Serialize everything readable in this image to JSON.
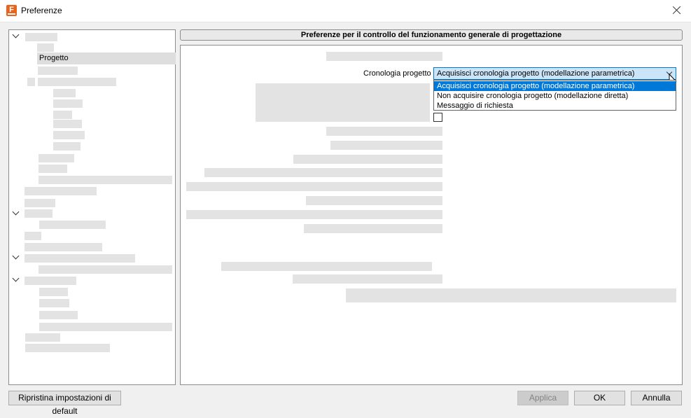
{
  "window": {
    "title": "Preferenze",
    "app_icon_letter": "F"
  },
  "tree": {
    "selected_item": "Progetto"
  },
  "main": {
    "header": "Preferenze per il controllo del funzionamento generale di progettazione",
    "cronologia": {
      "label": "Cronologia progetto",
      "selected": "Acquisisci cronologia progetto (modellazione parametrica)",
      "options": [
        "Acquisisci cronologia progetto (modellazione parametrica)",
        "Non acquisire cronologia progetto (modellazione diretta)",
        "Messaggio di richiesta"
      ]
    }
  },
  "footer": {
    "reset_label": "Ripristina impostazioni di default",
    "apply_label": "Applica",
    "ok_label": "OK",
    "cancel_label": "Annulla"
  },
  "colors": {
    "accent": "#0078d7",
    "combo_bg": "#cce4f7",
    "app_icon": "#e8641c"
  }
}
